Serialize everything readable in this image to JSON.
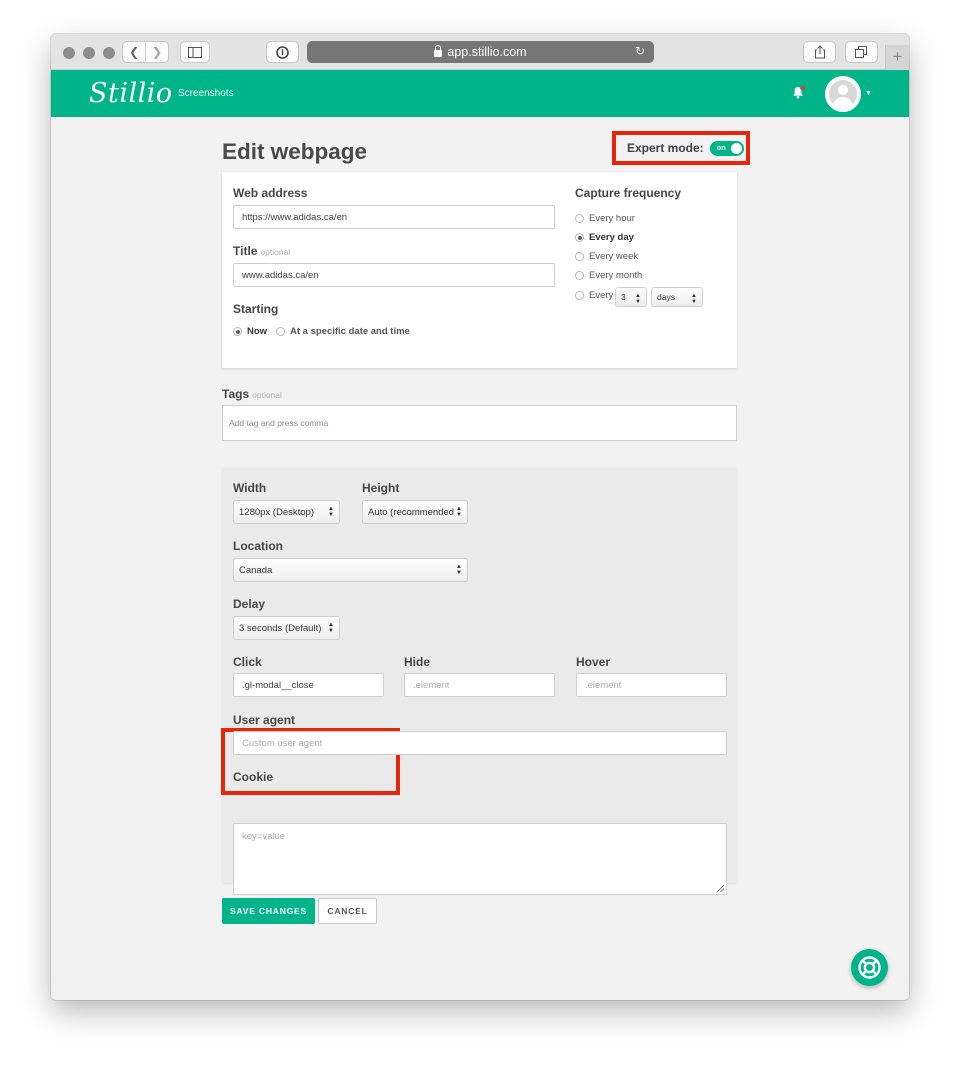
{
  "browser": {
    "url": "app.stillio.com",
    "new_tab_label": "+"
  },
  "app": {
    "logo": "Stillio",
    "nav_screenshots": "Screenshots"
  },
  "page": {
    "title": "Edit webpage",
    "expert_mode_label": "Expert mode:",
    "expert_mode_state": "on"
  },
  "form": {
    "web_address_label": "Web address",
    "web_address_value": "https://www.adidas.ca/en",
    "title_label": "Title",
    "optional_text": "optional",
    "title_value": "www.adidas.ca/en",
    "starting_label": "Starting",
    "starting_options": [
      "Now",
      "At a specific date and time"
    ],
    "capture_label": "Capture frequency",
    "capture_options": [
      "Every hour",
      "Every day",
      "Every week",
      "Every month",
      "Every"
    ],
    "every_count": "3",
    "every_unit": "days",
    "tags_label": "Tags",
    "tags_placeholder": "Add tag and press comma"
  },
  "expert": {
    "width_label": "Width",
    "width_value": "1280px (Desktop)",
    "height_label": "Height",
    "height_value": "Auto (recommended",
    "location_label": "Location",
    "location_value": "Canada",
    "delay_label": "Delay",
    "delay_value": "3 seconds (Default)",
    "click_label": "Click",
    "click_value": ".gl-modal__close",
    "hide_label": "Hide",
    "hide_placeholder": ".element",
    "hover_label": "Hover",
    "hover_placeholder": ".element",
    "user_agent_label": "User agent",
    "user_agent_placeholder": "Custom user agent",
    "cookie_label": "Cookie",
    "cookie_placeholder": "key=value"
  },
  "actions": {
    "save": "SAVE CHANGES",
    "cancel": "CANCEL"
  },
  "colors": {
    "brand": "#00b48a",
    "highlight": "#e8240a"
  }
}
